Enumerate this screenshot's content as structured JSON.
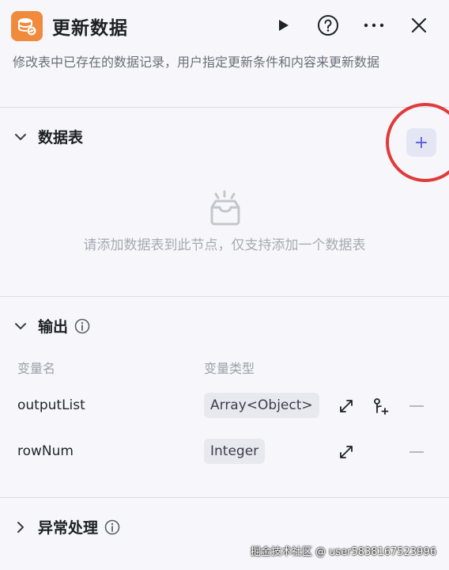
{
  "header": {
    "title": "更新数据",
    "icons": [
      "database-sync-icon",
      "play-icon",
      "help-icon",
      "more-icon",
      "close-icon"
    ],
    "accent": "#f08a3c"
  },
  "description": "修改表中已存在的数据记录，用户指定更新条件和内容来更新数据",
  "datatable": {
    "title": "数据表",
    "add_label": "+",
    "empty_text": "请添加数据表到此节点，仅支持添加一个数据表"
  },
  "output": {
    "title": "输出",
    "columns": [
      "变量名",
      "变量类型"
    ],
    "rows": [
      {
        "name": "outputList",
        "type": "Array<Object>"
      },
      {
        "name": "rowNum",
        "type": "Integer"
      }
    ]
  },
  "exception": {
    "title": "异常处理"
  },
  "watermark": "掘金技术社区 @ user5838167523996",
  "colors": {
    "highlight_circle": "#e03b3b",
    "add_button_bg": "#e5e6f4",
    "add_button_fg": "#5a60d6"
  }
}
